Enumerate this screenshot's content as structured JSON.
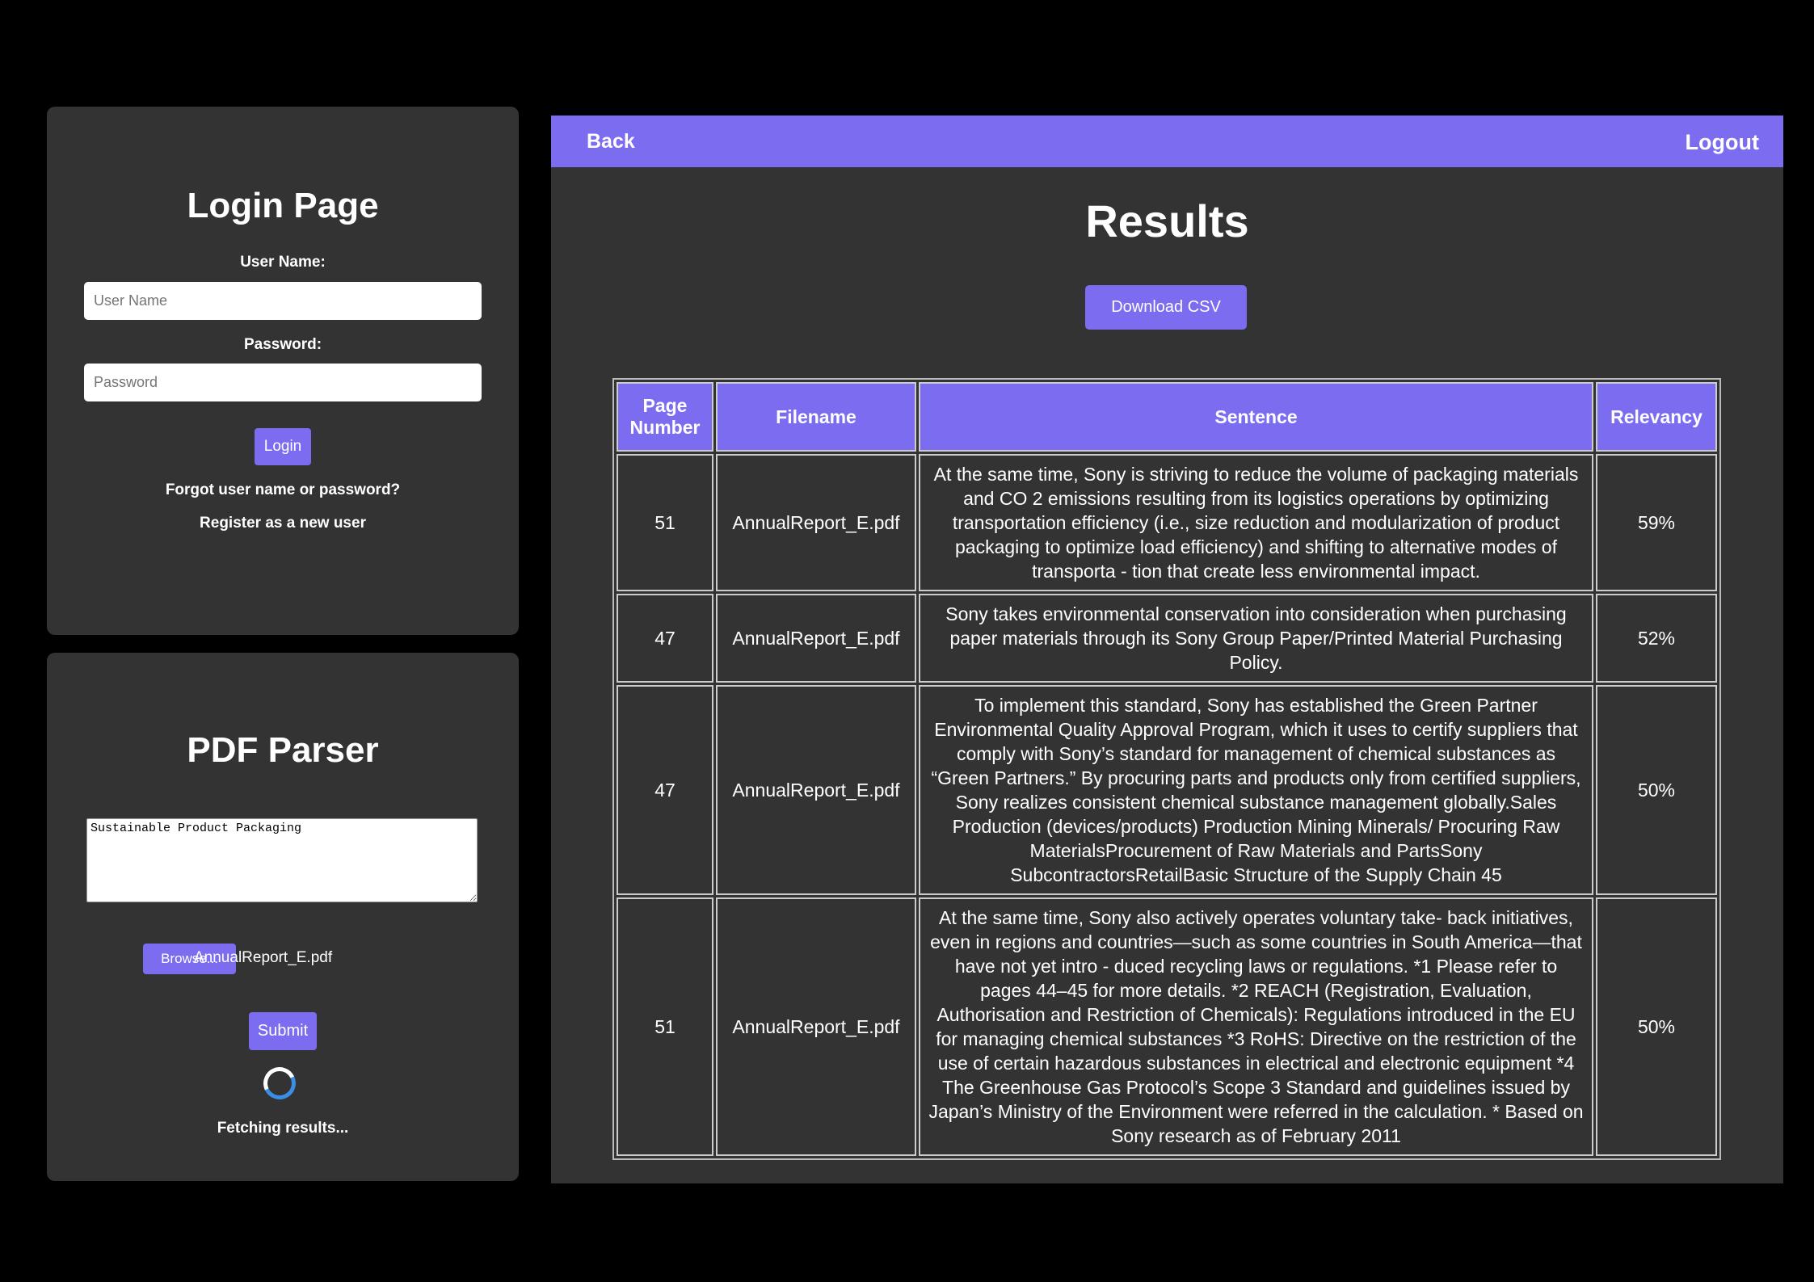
{
  "login": {
    "title": "Login Page",
    "username_label": "User Name:",
    "username_placeholder": "User Name",
    "password_label": "Password:",
    "password_placeholder": "Password",
    "login_button": "Login",
    "forgot_link": "Forgot user name or password?",
    "register_link": "Register as a new user"
  },
  "parser": {
    "title": "PDF Parser",
    "query_value": "Sustainable Product Packaging",
    "browse_button": "Browse...",
    "file_name": "AnnualReport_E.pdf",
    "submit_button": "Submit",
    "status_text": "Fetching results..."
  },
  "results": {
    "back_link": "Back",
    "logout_link": "Logout",
    "title": "Results",
    "download_button": "Download CSV",
    "columns": [
      "Page\nNumber",
      "Filename",
      "Sentence",
      "Relevancy"
    ],
    "rows": [
      {
        "page": "51",
        "filename": "AnnualReport_E.pdf",
        "sentence": "At the same time, Sony is striving to reduce the volume of packaging materials and CO 2 emissions resulting from its logistics operations by optimizing transportation efficiency (i.e., size reduction and modularization of product packaging to optimize load efficiency) and shifting to alternative modes of transporta - tion that create less environmental impact.",
        "relevancy": "59%"
      },
      {
        "page": "47",
        "filename": "AnnualReport_E.pdf",
        "sentence": "Sony takes environmental conservation into consideration when purchasing paper materials through its Sony Group Paper/Printed Material Purchasing Policy.",
        "relevancy": "52%"
      },
      {
        "page": "47",
        "filename": "AnnualReport_E.pdf",
        "sentence": "To implement this standard, Sony has established the Green Partner Environmental Quality Approval Program, which it uses to certify suppliers that comply with Sony’s standard for management of chemical substances as “Green Partners.” By procuring parts and products only from certified suppliers, Sony realizes consistent chemical substance management globally.Sales Production (devices/products) Production Mining Minerals/ Procuring Raw MaterialsProcurement of Raw Materials and PartsSony SubcontractorsRetailBasic Structure of the Supply Chain 45",
        "relevancy": "50%"
      },
      {
        "page": "51",
        "filename": "AnnualReport_E.pdf",
        "sentence": "At the same time, Sony also actively operates voluntary take- back initiatives, even in regions and countries—such as some countries in South America—that have not yet intro - duced recycling laws or regulations. *1 Please refer to pages 44–45 for more details. *2 REACH (Registration, Evaluation, Authorisation and Restriction of Chemicals): Regulations introduced in the EU for managing chemical substances *3 RoHS: Directive on the restriction of the use of certain hazardous substances in electrical and electronic equipment *4 The Greenhouse Gas Protocol’s Scope 3 Standard and guidelines issued by Japan’s Ministry of the Environment were referred in the calculation. * Based on Sony research as of February 2011",
        "relevancy": "50%"
      }
    ]
  },
  "colors": {
    "accent": "#7b6cf0",
    "panel": "#333333",
    "background": "#000000"
  }
}
